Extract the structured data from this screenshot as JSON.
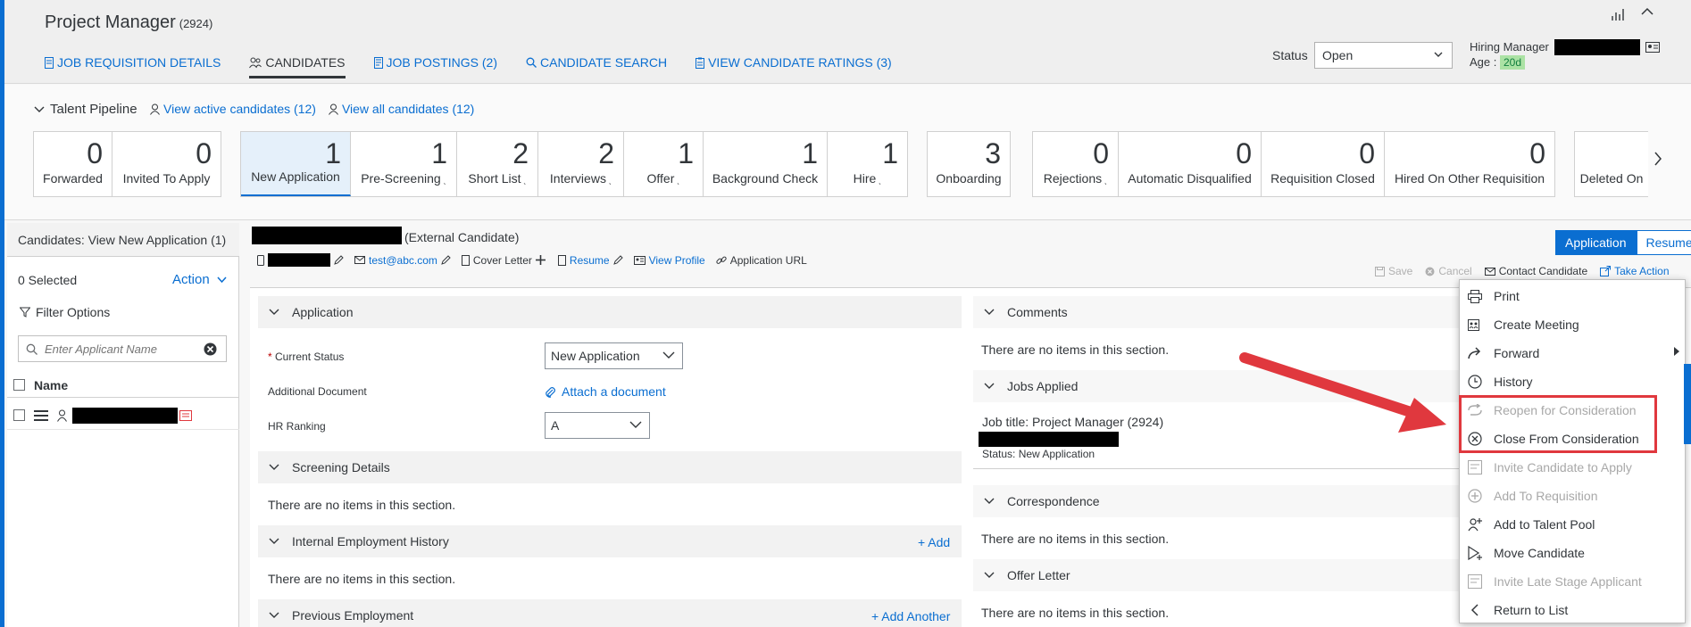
{
  "header": {
    "title": "Project Manager",
    "count": "(2924)",
    "tabs": [
      {
        "label": "JOB REQUISITION DETAILS"
      },
      {
        "label": "CANDIDATES"
      },
      {
        "label": "JOB POSTINGS (2)"
      },
      {
        "label": "CANDIDATE SEARCH"
      },
      {
        "label": "VIEW CANDIDATE RATINGS (3)"
      }
    ],
    "status_label": "Status",
    "status_value": "Open",
    "hiring_manager_label": "Hiring Manager",
    "age_label": "Age :",
    "age_value": "20d"
  },
  "pipeline": {
    "title": "Talent Pipeline",
    "view_active": "View active candidates (12)",
    "view_all": "View all candidates (12)",
    "stages": [
      {
        "count": "0",
        "label": "Forwarded"
      },
      {
        "count": "0",
        "label": "Invited To Apply"
      },
      {
        "count": "1",
        "label": "New Application"
      },
      {
        "count": "1",
        "label": "Pre-Screening"
      },
      {
        "count": "2",
        "label": "Short List"
      },
      {
        "count": "2",
        "label": "Interviews"
      },
      {
        "count": "1",
        "label": "Offer"
      },
      {
        "count": "1",
        "label": "Background Check"
      },
      {
        "count": "1",
        "label": "Hire"
      },
      {
        "count": "3",
        "label": "Onboarding"
      },
      {
        "count": "0",
        "label": "Rejections"
      },
      {
        "count": "0",
        "label": "Automatic Disqualified"
      },
      {
        "count": "0",
        "label": "Requisition Closed"
      },
      {
        "count": "0",
        "label": "Hired On Other Requisition"
      },
      {
        "count": "",
        "label": "Deleted On"
      }
    ]
  },
  "candidates_panel": {
    "title": "Candidates: View New Application (1)",
    "selected": "0 Selected",
    "action": "Action",
    "filter": "Filter Options",
    "search_placeholder": "Enter Applicant Name",
    "col_name": "Name"
  },
  "candidate": {
    "type": "(External Candidate)",
    "email": "test@abc.com",
    "cover_letter": "Cover Letter",
    "resume": "Resume",
    "view_profile": "View Profile",
    "application_url": "Application URL",
    "btn_application": "Application",
    "btn_resume": "Resume",
    "save": "Save",
    "cancel": "Cancel",
    "contact": "Contact Candidate",
    "take_action": "Take Action"
  },
  "sections": {
    "application": "Application",
    "current_status_label": "Current Status",
    "current_status_value": "New Application",
    "additional_doc_label": "Additional Document",
    "attach_doc": "Attach a document",
    "hr_ranking_label": "HR Ranking",
    "hr_ranking_value": "A",
    "screening": "Screening Details",
    "screening_empty": "There are no items in this section.",
    "internal_emp": "Internal Employment History",
    "internal_add": "+ Add",
    "internal_empty": "There are no items in this section.",
    "previous_emp": "Previous Employment",
    "previous_add": "+ Add Another",
    "comments": "Comments",
    "comments_empty": "There are no items in this section.",
    "jobs_applied": "Jobs Applied",
    "job_title": "Job title: Project Manager (2924)",
    "job_status": "Status: New Application",
    "correspondence": "Correspondence",
    "correspondence_empty": "There are no items in this section.",
    "offer_letter": "Offer Letter",
    "offer_empty": "There are no items in this section."
  },
  "menu": {
    "items": [
      {
        "label": "Print"
      },
      {
        "label": "Create Meeting"
      },
      {
        "label": "Forward"
      },
      {
        "label": "History"
      },
      {
        "label": "Reopen for Consideration"
      },
      {
        "label": "Close From Consideration"
      },
      {
        "label": "Invite Candidate to Apply"
      },
      {
        "label": "Add To Requisition"
      },
      {
        "label": "Add to Talent Pool"
      },
      {
        "label": "Move Candidate"
      },
      {
        "label": "Invite Late Stage Applicant"
      },
      {
        "label": "Return to List"
      }
    ]
  },
  "colors": {
    "accent": "#0a6ed1",
    "highlight": "#e0383e"
  }
}
